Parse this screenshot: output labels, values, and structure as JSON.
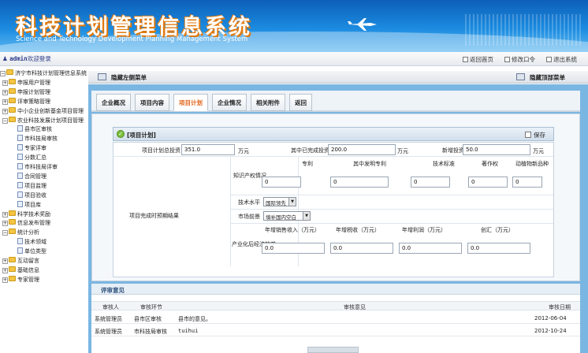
{
  "header": {
    "title": "科技计划管理信息系统",
    "subtitle": "Science and Technology Development Planning Management System"
  },
  "topbar": {
    "user": "admin",
    "welcome": "欢迎登录",
    "links": [
      "返回首页",
      "修改口令",
      "退出系统"
    ]
  },
  "sidebar": {
    "items": [
      {
        "label": "济宁市科技计划管理信息系统",
        "level": 0,
        "expanded": true,
        "type": "folder"
      },
      {
        "label": "申报用户管理",
        "level": 1,
        "expanded": false,
        "type": "folder"
      },
      {
        "label": "申报计划管理",
        "level": 1,
        "expanded": false,
        "type": "folder"
      },
      {
        "label": "评审策略管理",
        "level": 1,
        "expanded": false,
        "type": "folder"
      },
      {
        "label": "中小企业创新基金项目管理",
        "level": 1,
        "expanded": false,
        "type": "folder"
      },
      {
        "label": "农业科技发展计划项目管理",
        "level": 1,
        "expanded": true,
        "type": "folder"
      },
      {
        "label": "县市区审核",
        "level": 2,
        "type": "page"
      },
      {
        "label": "市科技局审核",
        "level": 2,
        "type": "page"
      },
      {
        "label": "专家评审",
        "level": 2,
        "type": "page"
      },
      {
        "label": "分数汇总",
        "level": 2,
        "type": "page"
      },
      {
        "label": "市科技局评审",
        "level": 2,
        "type": "page"
      },
      {
        "label": "合同管理",
        "level": 2,
        "type": "page"
      },
      {
        "label": "项目监理",
        "level": 2,
        "type": "page"
      },
      {
        "label": "项目验收",
        "level": 2,
        "type": "page"
      },
      {
        "label": "项目库",
        "level": 2,
        "type": "page"
      },
      {
        "label": "科学技术奖励",
        "level": 1,
        "expanded": false,
        "type": "folder"
      },
      {
        "label": "信息发布管理",
        "level": 1,
        "expanded": false,
        "type": "folder"
      },
      {
        "label": "统计分析",
        "level": 1,
        "expanded": true,
        "type": "folder"
      },
      {
        "label": "技术领域",
        "level": 2,
        "type": "page"
      },
      {
        "label": "单位类型",
        "level": 2,
        "type": "page"
      },
      {
        "label": "互动留言",
        "level": 1,
        "expanded": false,
        "type": "folder"
      },
      {
        "label": "基础信息",
        "level": 1,
        "expanded": false,
        "type": "folder"
      },
      {
        "label": "专家管理",
        "level": 1,
        "expanded": false,
        "type": "folder"
      }
    ]
  },
  "menubar": {
    "hide_left": "隐藏左侧菜单",
    "hide_top": "隐藏顶部菜单"
  },
  "tabs": [
    {
      "label": "企业概况",
      "active": false
    },
    {
      "label": "项目内容",
      "active": false
    },
    {
      "label": "项目计划",
      "active": true
    },
    {
      "label": "企业情况",
      "active": false
    },
    {
      "label": "相关附件",
      "active": false
    },
    {
      "label": "返回",
      "active": false
    }
  ],
  "panel": {
    "title": "[项目计划]",
    "save": "保存"
  },
  "form": {
    "total_invest_label": "项目计划总投资",
    "total_invest_value": "351.0",
    "unit_wan": "万元",
    "completed_invest_label": "其中已完成投资",
    "completed_invest_value": "200.0",
    "new_invest_label": "新增投资",
    "new_invest_value": "50.0",
    "expected_results_label": "项目完成时预期结果",
    "ip_label": "知识产权情况",
    "ip_cols": [
      "专利",
      "其中发明专利",
      "技术标准",
      "著作权",
      "动植物新品种"
    ],
    "ip_values": [
      "0",
      "0",
      "0",
      "0",
      "0"
    ],
    "tech_level_label": "技术水平",
    "tech_level_value": "国际领先",
    "market_label": "市场前景",
    "market_value": "填补国内空白",
    "benefit_label": "产业化后经济效益",
    "benefit_cols": [
      "年增销售收入（万元）",
      "年增税收（万元）",
      "年增利润（万元）",
      "创汇（万元）"
    ],
    "benefit_values": [
      "0.0",
      "0.0",
      "0.0",
      "0.0"
    ]
  },
  "review": {
    "title": "评审意见",
    "columns": [
      "审核人",
      "审核环节",
      "审核意见",
      "审核日期"
    ],
    "rows": [
      {
        "reviewer": "系统管理员",
        "stage": "县市区审核",
        "opinion": "县市的意见。",
        "date": "2012-06-04"
      },
      {
        "reviewer": "系统管理员",
        "stage": "市科技局审核",
        "opinion": "tuihui",
        "date": "2012-10-24"
      }
    ]
  }
}
